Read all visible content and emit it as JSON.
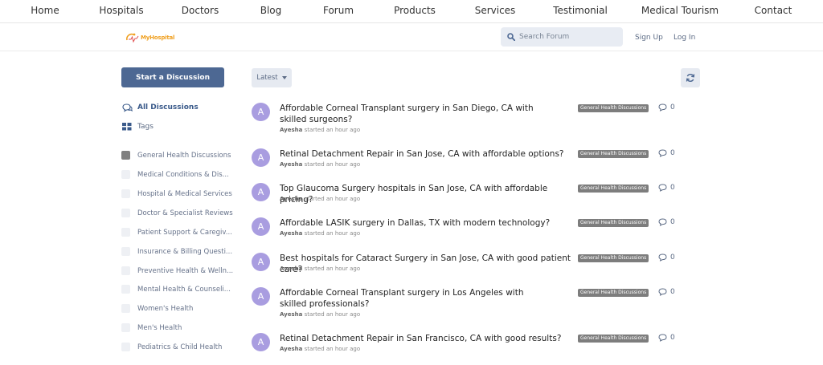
{
  "nav": {
    "items": [
      "Home",
      "Hospitals",
      "Doctors",
      "Blog",
      "Forum",
      "Products",
      "Services",
      "Testimonial",
      "Medical Tourism",
      "Contact"
    ]
  },
  "header": {
    "logo_text": "MyHospital",
    "search_placeholder": "Search Forum",
    "signup": "Sign Up",
    "login": "Log In"
  },
  "sidebar": {
    "start_button": "Start a Discussion",
    "all_discussions": "All Discussions",
    "tags": "Tags",
    "tag_list": [
      "General Health Discussions",
      "Medical Conditions & Dis...",
      "Hospital & Medical Services",
      "Doctor & Specialist Reviews",
      "Patient Support & Caregiv...",
      "Insurance & Billing Questi...",
      "Preventive Health & Welln...",
      "Mental Health & Counseli...",
      "Women's Health",
      "Men's Health",
      "Pediatrics & Child Health"
    ]
  },
  "toolbar": {
    "sort_label": "Latest"
  },
  "discussions": [
    {
      "avatar": "A",
      "title": "Affordable Corneal Transplant surgery in San Diego, CA with skilled surgeons?",
      "author": "Ayesha",
      "time": "started an hour ago",
      "tag": "General Health Discussions",
      "replies": "0"
    },
    {
      "avatar": "A",
      "title": "Retinal Detachment Repair in San Jose, CA with affordable options?",
      "author": "Ayesha",
      "time": "started an hour ago",
      "tag": "General Health Discussions",
      "replies": "0"
    },
    {
      "avatar": "A",
      "title": "Top Glaucoma Surgery hospitals in San Jose, CA with affordable pricing?",
      "author": "Ayesha",
      "time": "started an hour ago",
      "tag": "General Health Discussions",
      "replies": "0"
    },
    {
      "avatar": "A",
      "title": "Affordable LASIK surgery in Dallas, TX with modern technology?",
      "author": "Ayesha",
      "time": "started an hour ago",
      "tag": "General Health Discussions",
      "replies": "0"
    },
    {
      "avatar": "A",
      "title": "Best hospitals for Cataract Surgery in San Jose, CA with good patient care?",
      "author": "Ayesha",
      "time": "started an hour ago",
      "tag": "General Health Discussions",
      "replies": "0"
    },
    {
      "avatar": "A",
      "title": "Affordable Corneal Transplant surgery in Los Angeles with skilled professionals?",
      "author": "Ayesha",
      "time": "started an hour ago",
      "tag": "General Health Discussions",
      "replies": "0"
    },
    {
      "avatar": "A",
      "title": "Retinal Detachment Repair in San Francisco, CA with good results?",
      "author": "Ayesha",
      "time": "started an hour ago",
      "tag": "General Health Discussions",
      "replies": "0"
    }
  ],
  "colors": {
    "accent": "#4d6893",
    "avatar": "#a99de0",
    "tag_bg": "#7d7d7d"
  }
}
